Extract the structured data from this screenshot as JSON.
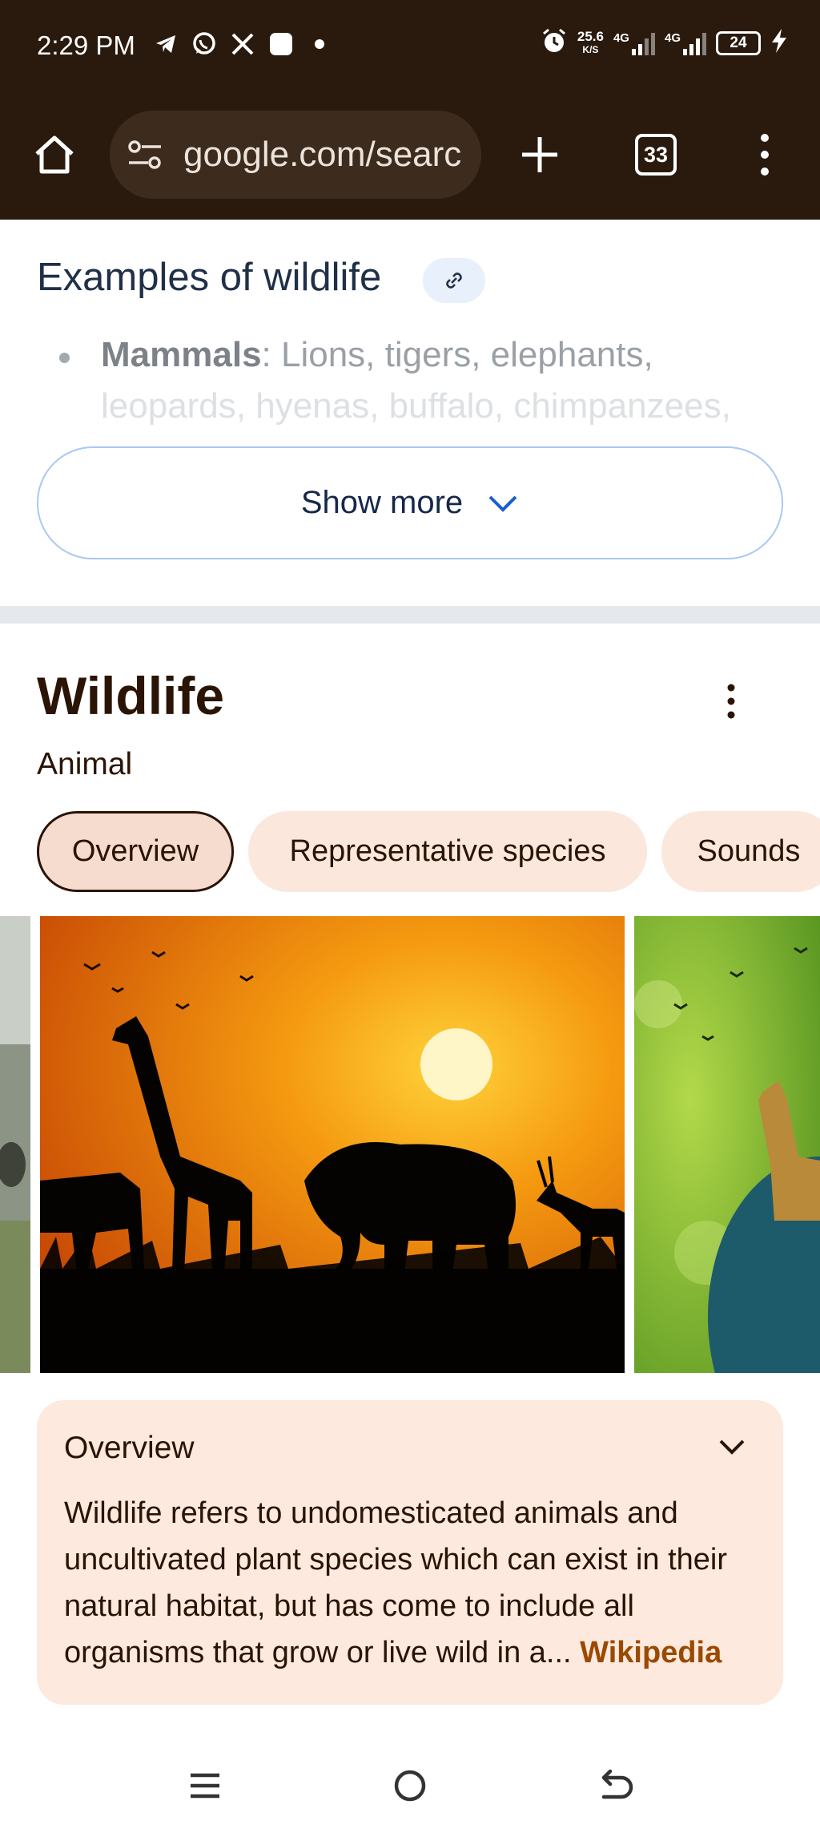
{
  "status_bar": {
    "time": "2:29 PM",
    "net_speed": "25.6",
    "net_unit": "K/S",
    "signal1_label": "4G",
    "signal2_label": "4G",
    "battery": "24",
    "icons": [
      "telegram-icon",
      "whatsapp-icon",
      "x-icon",
      "app-square-icon",
      "dot-icon",
      "alarm-icon",
      "charging-icon"
    ]
  },
  "browser": {
    "url": "google.com/search",
    "tab_count": "33"
  },
  "examples": {
    "title": "Examples of wildlife",
    "bullet_label": "Mammals",
    "bullet_text": ": Lions, tigers, elephants,",
    "bullet_text_faded": "leopards, hyenas, buffalo, chimpanzees,",
    "show_more_label": "Show more"
  },
  "entity": {
    "title": "Wildlife",
    "subtitle": "Animal",
    "chips": [
      "Overview",
      "Representative species",
      "Sounds"
    ],
    "active_chip": "Overview"
  },
  "overview": {
    "title": "Overview",
    "text": "Wildlife refers to undomesticated animals and uncultivated plant species which can exist in their natural habitat, but has come to include all organisms that grow or live wild in a",
    "ellipsis": "...",
    "source_link": "Wikipedia"
  },
  "colors": {
    "chrome_bg": "#2a1a0e",
    "accent_link": "#9a4a00",
    "chip_bg": "#fce7dc"
  }
}
